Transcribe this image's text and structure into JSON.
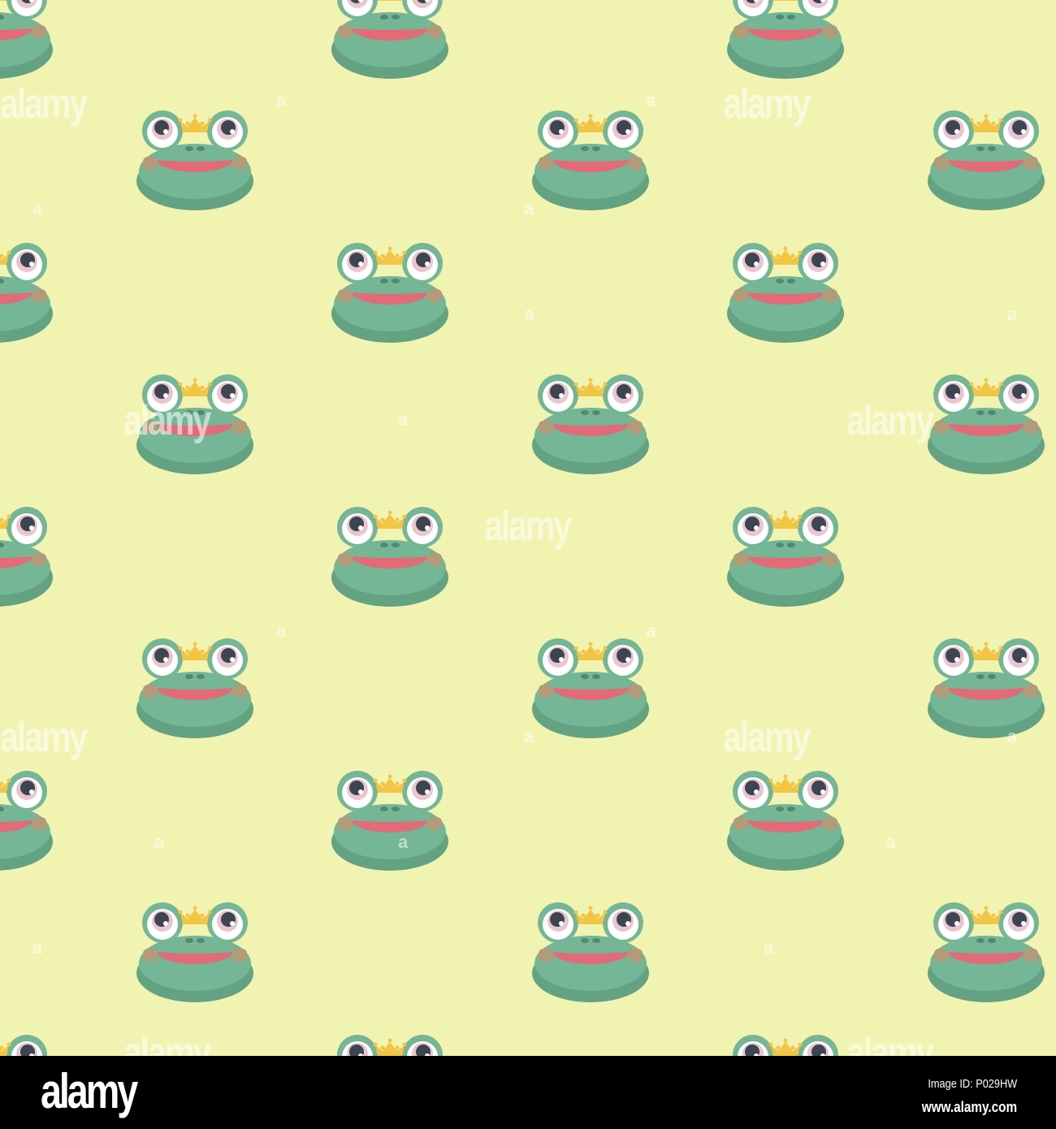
{
  "pattern": {
    "background_color": "#f1f3b0",
    "motif": "frog-prince-face",
    "colors": {
      "body": "#74b695",
      "body_shadow": "#63a283",
      "mouth": "#e36a77",
      "cheek": "#b29b78",
      "crown": "#f2c544",
      "pupil": "#3d4452"
    },
    "watermark_text": "alamy",
    "watermark_letter": "a"
  },
  "footer": {
    "logo": "alamy",
    "image_id": "Image ID: P029HW",
    "website": "www.alamy.com"
  }
}
